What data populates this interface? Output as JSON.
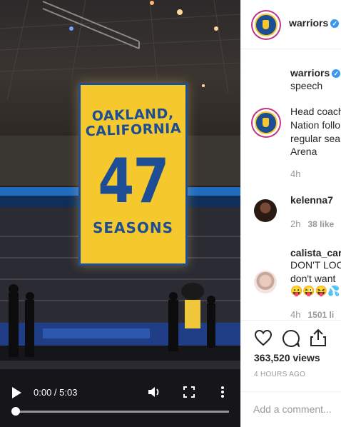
{
  "video": {
    "banner": {
      "line1": "OAKLAND,",
      "line2": "CALIFORNIA",
      "number": "47",
      "subtitle": "SEASONS"
    },
    "controls": {
      "time": "0:00 / 5:03",
      "progress_fraction": 0
    }
  },
  "sidebar": {
    "header": {
      "username": "warriors",
      "avatar": "warriors-logo"
    },
    "caption": {
      "username": "warriors",
      "text": "speech"
    },
    "comments": [
      {
        "lines": [
          "Head coach",
          "Nation follo",
          "regular sea",
          "Arena"
        ],
        "time": "4h"
      },
      {
        "username": "kelenna7",
        "time": "2h",
        "likes": "38 like"
      },
      {
        "username": "calista_car",
        "lines": [
          "DON'T LOC",
          "don't want"
        ],
        "emoji": "😛😜😝💦",
        "time": "4h",
        "likes": "1501 li"
      }
    ],
    "actions": {
      "views": "363,520 views",
      "posted": "4 HOURS AGO"
    },
    "add_comment": {
      "placeholder": "Add a comment..."
    }
  },
  "colors": {
    "banner_yellow": "#f5c92d",
    "warriors_blue": "#1d4e95",
    "verified_blue": "#3897f0"
  }
}
